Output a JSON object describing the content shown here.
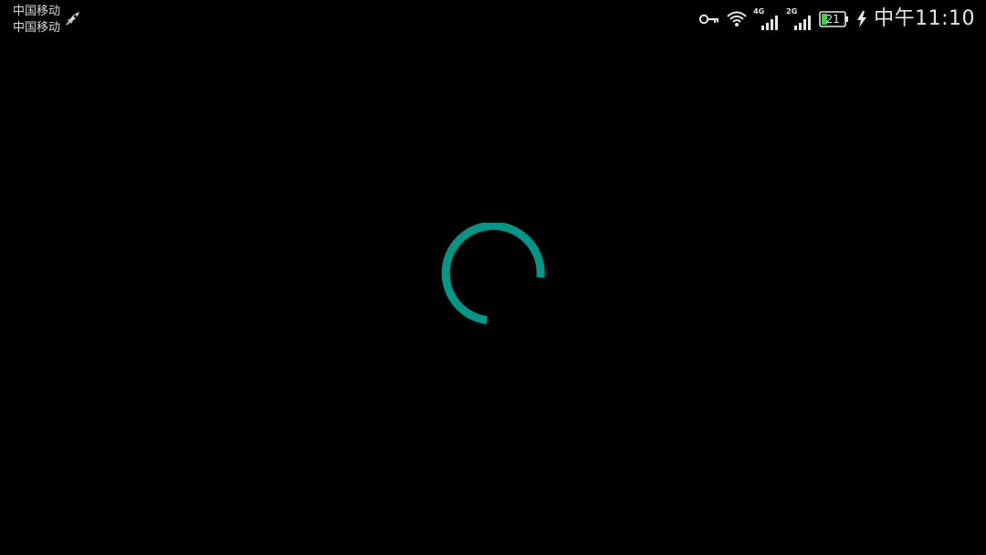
{
  "status_bar": {
    "carriers": [
      "中国移动",
      "中国移动"
    ],
    "network1": "4G",
    "network2": "2G",
    "battery_level": "21",
    "time": "中午11:10",
    "icons": [
      "rocket-icon",
      "key-icon",
      "wifi-icon",
      "signal-icon",
      "battery-icon",
      "charging-icon"
    ]
  },
  "loading": {
    "indicator": "progress-spinner",
    "accent_color": "#009688"
  }
}
